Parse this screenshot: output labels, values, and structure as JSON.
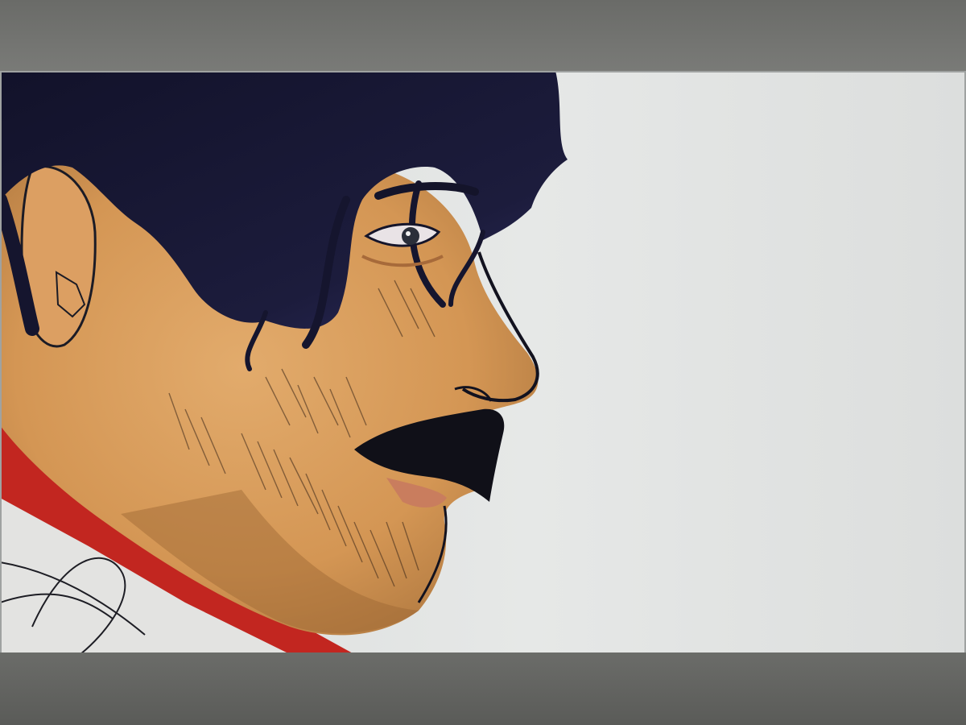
{
  "scene": {
    "subject": "digital-drawing-on-screen",
    "palette": {
      "skin": "#d69a5a",
      "skin_shadow": "#a8703a",
      "hair": "#17172e",
      "hair_highlight": "#2b2a5a",
      "shirt_collar": "#c0241e",
      "shirt": "#e6e6e4",
      "background": "#e4e6e5",
      "bezel": "#6f6f6c"
    }
  }
}
